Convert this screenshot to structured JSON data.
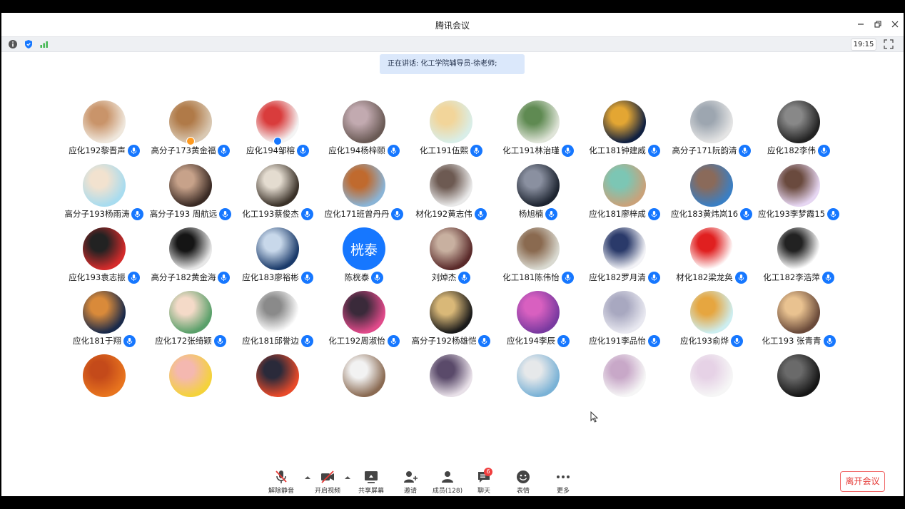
{
  "window": {
    "title": "腾讯会议"
  },
  "info_bar": {
    "time": "19:15"
  },
  "speaking": {
    "text": "正在讲话: 化工学院辅导员-徐老师;"
  },
  "colors": {
    "accent": "#1677ff",
    "leave": "#e53935",
    "badge": "#f03e3e"
  },
  "participants": [
    {
      "name": "应化192黎晋声",
      "avatar": "dog-photo",
      "colors": [
        "#efe7dc",
        "#c9946a"
      ]
    },
    {
      "name": "高分子173黄金福",
      "avatar": "dog-photo",
      "colors": [
        "#d9c8b2",
        "#b07a48"
      ],
      "badge": "orange"
    },
    {
      "name": "应化194邹榕",
      "avatar": "cat-cartoon",
      "colors": [
        "#f4f4f4",
        "#d93c3c"
      ],
      "badge": "blue"
    },
    {
      "name": "应化194杨梓颐",
      "avatar": "collage-photo",
      "colors": [
        "#6a5a55",
        "#c2aab0"
      ]
    },
    {
      "name": "化工191伍熙",
      "avatar": "girl-illustration",
      "colors": [
        "#d9eee8",
        "#f2d59a"
      ]
    },
    {
      "name": "化工191林治瑾",
      "avatar": "frog-toy",
      "colors": [
        "#dfe4d8",
        "#5f8a52"
      ]
    },
    {
      "name": "化工181钟建威",
      "avatar": "night-scene",
      "colors": [
        "#102040",
        "#e3a633"
      ]
    },
    {
      "name": "高分子171阮韵清",
      "avatar": "family-photo",
      "colors": [
        "#e4e4e4",
        "#9da6b0"
      ]
    },
    {
      "name": "应化182李伟",
      "avatar": "mono-photo",
      "colors": [
        "#222222",
        "#888888"
      ]
    },
    {
      "name": "高分子193杨雨涛",
      "avatar": "anime-boy",
      "colors": [
        "#a8dcef",
        "#f2e2cf"
      ]
    },
    {
      "name": "高分子193 周航远",
      "avatar": "girl-photo",
      "colors": [
        "#3a2a24",
        "#c7a28a"
      ]
    },
    {
      "name": "化工193蔡俊杰",
      "avatar": "girl-photo",
      "colors": [
        "#3a3128",
        "#e4dcd0"
      ]
    },
    {
      "name": "应化171班曾丹丹",
      "avatar": "bear-toy",
      "colors": [
        "#8ab4d6",
        "#c06a2e"
      ]
    },
    {
      "name": "材化192黄志伟",
      "avatar": "man-photo",
      "colors": [
        "#e9e9e9",
        "#6d5a52"
      ]
    },
    {
      "name": "杨旭楠",
      "avatar": "dark-portrait",
      "colors": [
        "#1d2430",
        "#8a90a0"
      ]
    },
    {
      "name": "应化181廖梓成",
      "avatar": "cartoon-creature",
      "colors": [
        "#c9a27a",
        "#7cc6b4"
      ]
    },
    {
      "name": "应化183黄炜岚16",
      "avatar": "cartoon-bear",
      "colors": [
        "#3a7fc4",
        "#8a6a5a"
      ]
    },
    {
      "name": "应化193李梦霞15",
      "avatar": "girl-photo",
      "colors": [
        "#e6d6f2",
        "#6a4a3e"
      ]
    },
    {
      "name": "应化193袁志振",
      "avatar": "anime-girl",
      "colors": [
        "#d42b2b",
        "#222222"
      ]
    },
    {
      "name": "高分子182黄金海",
      "avatar": "panda-photo",
      "colors": [
        "#e7e7e7",
        "#151515"
      ]
    },
    {
      "name": "应化183廖裕彬",
      "avatar": "sky-photo",
      "colors": [
        "#1a3a6a",
        "#c8d8ea"
      ]
    },
    {
      "name": "陈桄泰",
      "avatar_text": "桄泰"
    },
    {
      "name": "刘焯杰",
      "avatar": "basketball-photo",
      "colors": [
        "#5a2a2a",
        "#c8b0a0"
      ]
    },
    {
      "name": "化工181陈伟怡",
      "avatar": "woman-photo",
      "colors": [
        "#d9d9d0",
        "#8a6a50"
      ]
    },
    {
      "name": "应化182罗月清",
      "avatar": "anime-boy",
      "colors": [
        "#f2f2f6",
        "#2a3a6a"
      ]
    },
    {
      "name": "材化182梁龙奂",
      "avatar": "red-flag",
      "colors": [
        "#ffffff",
        "#e02020"
      ]
    },
    {
      "name": "化工182李浩萍",
      "avatar": "line-drawing",
      "colors": [
        "#ffffff",
        "#222222"
      ]
    },
    {
      "name": "应化181于翔",
      "avatar": "dog-photo",
      "colors": [
        "#1a2a4a",
        "#d98a3a"
      ]
    },
    {
      "name": "应化172张绮颖",
      "avatar": "baby-photo",
      "colors": [
        "#5aa06a",
        "#f4dac8"
      ]
    },
    {
      "name": "应化181邱誉边",
      "avatar": "rabbit-sketch",
      "colors": [
        "#ffffff",
        "#8a8a8a"
      ]
    },
    {
      "name": "化工192周淑怡",
      "avatar": "girl-pink",
      "colors": [
        "#e04a8a",
        "#3a2a3a"
      ]
    },
    {
      "name": "高分子192杨雄恺",
      "avatar": "eiffel-photo",
      "colors": [
        "#1a1a1a",
        "#d9b878"
      ]
    },
    {
      "name": "应化194李辰",
      "avatar": "purple-sky",
      "colors": [
        "#7a3aa0",
        "#d860c0"
      ]
    },
    {
      "name": "应化191李品怡",
      "avatar": "jellyfish-cartoon",
      "colors": [
        "#e8e8f0",
        "#a8a8c0"
      ]
    },
    {
      "name": "应化193俞烨",
      "avatar": "fox-cartoon",
      "colors": [
        "#cdeef0",
        "#e6a640"
      ]
    },
    {
      "name": "化工193 张青青",
      "avatar": "dog-photo",
      "colors": [
        "#6a4a3a",
        "#e9c290"
      ]
    },
    {
      "name": "",
      "avatar": "sunset-photo",
      "colors": [
        "#e8741e",
        "#c44a1a"
      ]
    },
    {
      "name": "",
      "avatar": "anime-girl",
      "colors": [
        "#f4d23a",
        "#f4b8b0"
      ]
    },
    {
      "name": "",
      "avatar": "anime-boy",
      "colors": [
        "#e84a2a",
        "#2a2a3a"
      ]
    },
    {
      "name": "",
      "avatar": "anime-old-man",
      "colors": [
        "#8a6a52",
        "#f2f2f2"
      ]
    },
    {
      "name": "",
      "avatar": "anime-boy",
      "colors": [
        "#e8e0e8",
        "#5a4a6a"
      ]
    },
    {
      "name": "",
      "avatar": "beach-photo",
      "colors": [
        "#7ab2d6",
        "#e6e8ea"
      ]
    },
    {
      "name": "",
      "avatar": "anime-girl",
      "colors": [
        "#f6f6f6",
        "#c8a8c8"
      ]
    },
    {
      "name": "",
      "avatar": "anime-sketch",
      "colors": [
        "#f6f6f6",
        "#e6d2e6"
      ]
    },
    {
      "name": "",
      "avatar": "dark-photo",
      "colors": [
        "#161616",
        "#6a6a6a"
      ]
    }
  ],
  "toolbar": {
    "unmute": "解除静音",
    "video": "开启视频",
    "share": "共享屏幕",
    "invite": "邀请",
    "members": "成员(128)",
    "chat": "聊天",
    "chat_badge": "6",
    "reactions": "表情",
    "more": "更多",
    "leave": "离开会议"
  }
}
